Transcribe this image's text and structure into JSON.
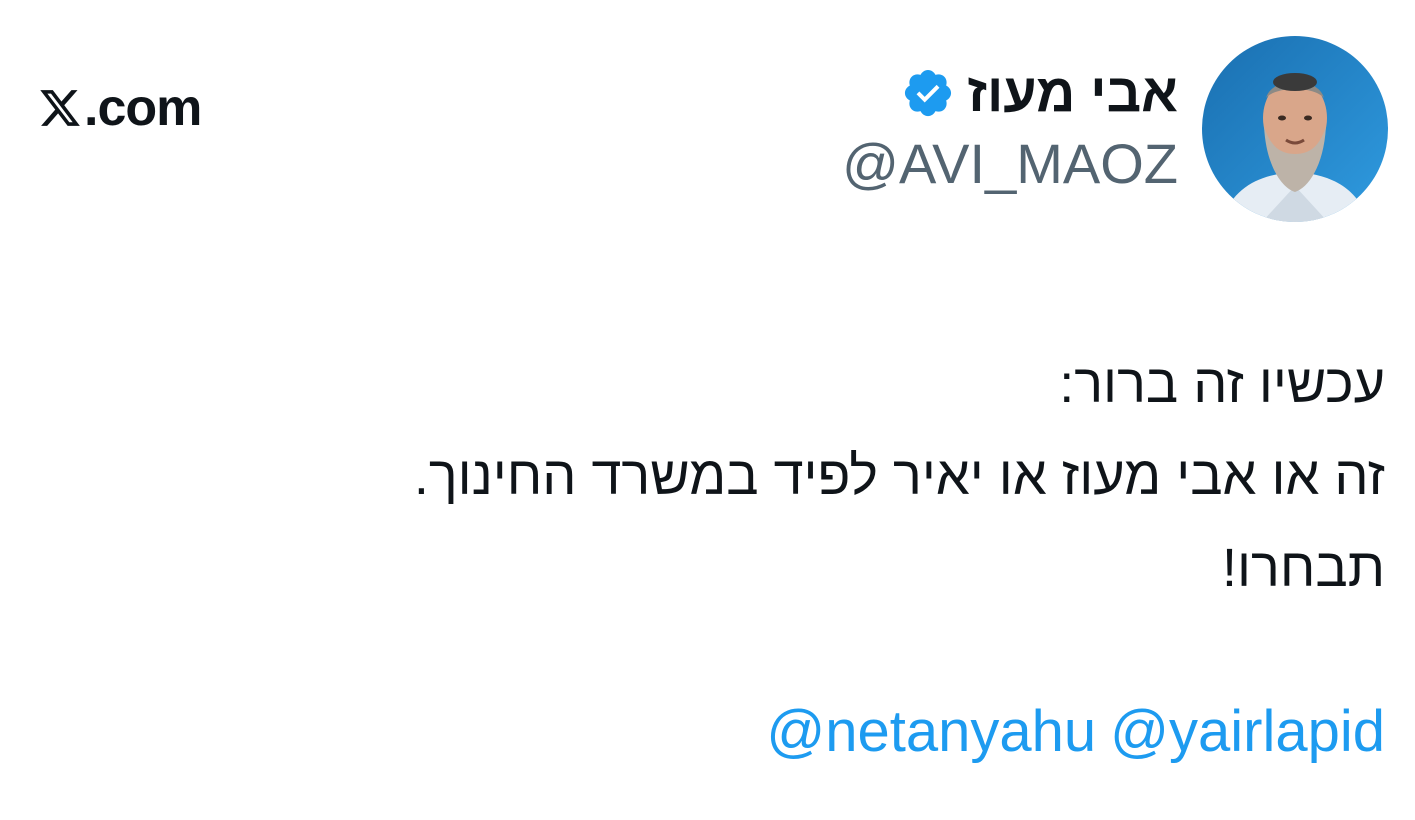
{
  "brand": {
    "logo_icon": "x-logo-icon",
    "text": ".com"
  },
  "author": {
    "display_name": "אבי מעוז",
    "handle": "@AVI_MAOZ",
    "verified_icon": "verified-badge-icon",
    "avatar_icon": "profile-photo"
  },
  "tweet": {
    "lines": [
      "עכשיו זה ברור:",
      "זה או אבי מעוז או יאיר לפיד במשרד החינוך.",
      "תבחרו!"
    ],
    "mentions": [
      "@netanyahu",
      "@yairlapid"
    ]
  },
  "colors": {
    "link": "#1d9bf0",
    "text": "#0f1419",
    "secondary": "#536471",
    "verified": "#1d9bf0"
  }
}
